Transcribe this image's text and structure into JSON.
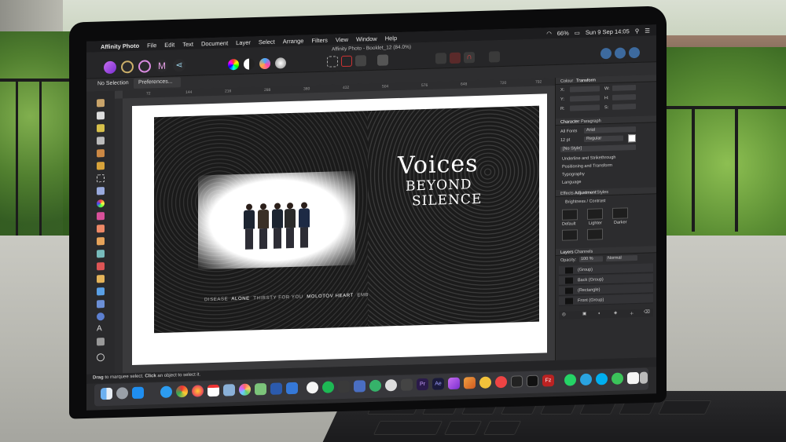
{
  "menubar": {
    "apple": "",
    "app_name": "Affinity Photo",
    "items": [
      "File",
      "Edit",
      "Text",
      "Document",
      "Layer",
      "Select",
      "Arrange",
      "Filters",
      "View",
      "Window",
      "Help"
    ],
    "battery": "66%",
    "datetime": "Sun 9 Sep 14:05"
  },
  "window": {
    "title": "Affinity Photo - Booklet_12 (84.0%)"
  },
  "context_bar": {
    "selection": "No Selection",
    "preferences": "Preferences..."
  },
  "rulers": {
    "h_ticks": [
      "72",
      "144",
      "216",
      "288",
      "360",
      "432",
      "504",
      "576",
      "648",
      "720",
      "792"
    ]
  },
  "document": {
    "tagline_parts": [
      {
        "text": "DISEASE",
        "bold": false
      },
      {
        "text": "ALONE",
        "bold": true
      },
      {
        "text": "THIRSTY FOR YOU",
        "bold": false
      },
      {
        "text": "MOLOTOV HEART",
        "bold": true
      },
      {
        "text": "EMBRACE",
        "bold": false
      }
    ],
    "title_line1": "Voices",
    "title_line2": "BEYOND",
    "title_line3": "SILENCE"
  },
  "studio": {
    "tabs_top": [
      "Colour",
      "Transform"
    ],
    "transform_fields": [
      "X:",
      "Y:",
      "W:",
      "H:",
      "R:",
      "S:"
    ],
    "tabs_char": [
      "Character",
      "Paragraph"
    ],
    "font_collection": "All Fonts",
    "font_name": "Arial",
    "font_size": "12 pt",
    "font_weight": "Regular",
    "text_style": "[No Style]",
    "sections": [
      "Underline and Strikethrough",
      "Positioning and Transform",
      "Typography",
      "Language"
    ],
    "tabs_effects": [
      "Effects",
      "Adjustment",
      "Styles"
    ],
    "adjustment_name": "Brightness / Contrast",
    "presets": [
      "Default",
      "Lighter",
      "Darker"
    ],
    "tabs_layers": [
      "Layers",
      "Channels"
    ],
    "opacity_label": "Opacity:",
    "opacity_value": "100 %",
    "blend_mode": "Normal",
    "layers": [
      "(Group)",
      "Back (Group)",
      "(Rectangle)",
      "Front (Group)"
    ]
  },
  "status": {
    "hint_prefix": "Drag",
    "hint_middle": "to marquee select.",
    "hint_click": "Click",
    "hint_suffix": "an object to select it."
  },
  "colors": {
    "accent": "#8a3bd6",
    "ui_dark": "#2a2a2c"
  },
  "dock_icons": [
    "finder-icon",
    "launchpad-icon",
    "appstore-icon",
    "safari-icon",
    "chrome-icon",
    "firefox-icon",
    "calendar-icon",
    "preview-icon",
    "photos-icon",
    "maps-icon",
    "word-icon",
    "keynote-icon",
    "music-icon",
    "spotify-icon",
    "vlc-icon",
    "camera-icon",
    "photoshop-icon",
    "premiere-icon",
    "aftereffects-icon",
    "affinity-icon",
    "affinity-photo-icon",
    "affinity-publisher-icon",
    "monitor-icon",
    "terminal-icon",
    "filezilla-icon",
    "whatsapp-icon",
    "telegram-icon",
    "skype-icon",
    "messages-icon",
    "document-icon",
    "trash-icon"
  ]
}
